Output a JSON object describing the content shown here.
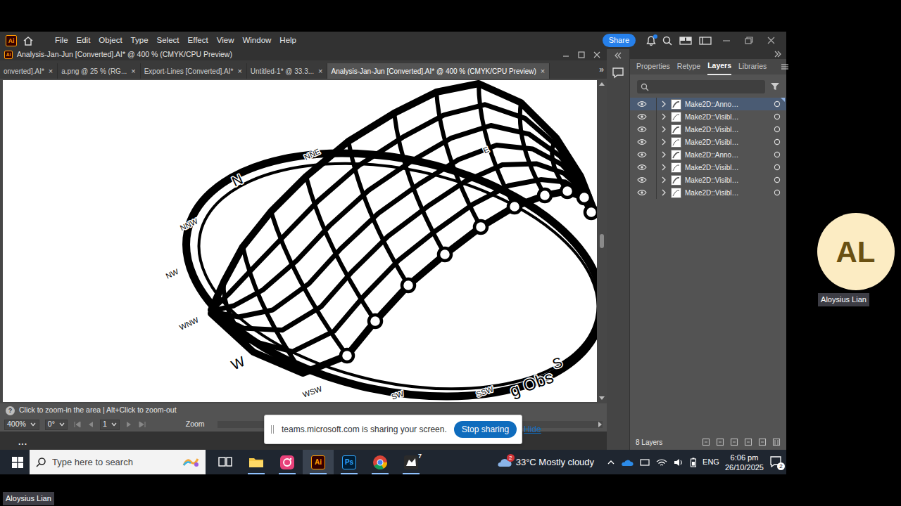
{
  "app": {
    "logo": "Ai",
    "menu": [
      "File",
      "Edit",
      "Object",
      "Type",
      "Select",
      "Effect",
      "View",
      "Window",
      "Help"
    ],
    "share": "Share",
    "notify": true
  },
  "document": {
    "title": "Analysis-Jan-Jun [Converted].AI* @ 400 % (CMYK/CPU Preview)"
  },
  "tabs": [
    {
      "label": "onverted].AI*",
      "selected": false
    },
    {
      "label": "a.png @ 25 % (RG...",
      "selected": false
    },
    {
      "label": "Export-Lines [Converted].AI*",
      "selected": false
    },
    {
      "label": "Untitled-1* @ 33.3...",
      "selected": false
    },
    {
      "label": "Analysis-Jan-Jun [Converted].AI* @ 400 % (CMYK/CPU Preview)",
      "selected": true
    }
  ],
  "tab_close": "×",
  "tab_overflow": "»",
  "canvas": {
    "labels": [
      "N",
      "NNE",
      "E",
      "NNW",
      "NW",
      "WNW",
      "W",
      "WSW",
      "SW",
      "SSW",
      "S",
      "g Obs"
    ]
  },
  "status": {
    "help": "?",
    "hint": "Click to zoom-in the area | Alt+Click to zoom-out",
    "zoom": "400%",
    "rotation": "0°",
    "artboard": "1",
    "tool": "Zoom"
  },
  "more": "...",
  "panel": {
    "tabs": [
      {
        "label": "Properties",
        "selected": false
      },
      {
        "label": "Retype",
        "selected": false
      },
      {
        "label": "Layers",
        "selected": true
      },
      {
        "label": "Libraries",
        "selected": false
      }
    ],
    "layers": [
      {
        "name": "Make2D::Anno…",
        "visible": true,
        "selected": true
      },
      {
        "name": "Make2D::Visibl…",
        "visible": true,
        "selected": false
      },
      {
        "name": "Make2D::Visibl…",
        "visible": true,
        "selected": false
      },
      {
        "name": "Make2D::Visibl…",
        "visible": true,
        "selected": false
      },
      {
        "name": "Make2D::Anno…",
        "visible": true,
        "selected": false
      },
      {
        "name": "Make2D::Visibl…",
        "visible": true,
        "selected": false
      },
      {
        "name": "Make2D::Visibl…",
        "visible": true,
        "selected": false
      },
      {
        "name": "Make2D::Visibl…",
        "visible": true,
        "selected": false
      }
    ],
    "count": "8 Layers"
  },
  "share_bar": {
    "message": "teams.microsoft.com is sharing your screen.",
    "stop": "Stop sharing",
    "hide": "Hide"
  },
  "taskbar": {
    "search": {
      "placeholder": "Type here to search"
    },
    "apps": [
      {
        "kind": "taskview",
        "running": false,
        "selected": false
      },
      {
        "kind": "explorer",
        "running": true,
        "selected": false
      },
      {
        "kind": "photos",
        "running": true,
        "selected": false
      },
      {
        "kind": "illustrator",
        "label": "Ai",
        "running": true,
        "selected": true
      },
      {
        "kind": "photoshop",
        "label": "Ps",
        "running": true,
        "selected": false
      },
      {
        "kind": "chrome",
        "running": true,
        "selected": false
      },
      {
        "kind": "rhino",
        "badge": "7",
        "running": true,
        "selected": false
      }
    ],
    "weather": "33°C Mostly cloudy",
    "weather_badge": "2",
    "lang": "ENG",
    "time": "6:06 pm",
    "date": "26/10/2025",
    "notifications": "2"
  },
  "participant": {
    "initials": "AL",
    "name": "Aloysius Lian"
  },
  "presenter": {
    "name": "Aloysius Lian"
  }
}
